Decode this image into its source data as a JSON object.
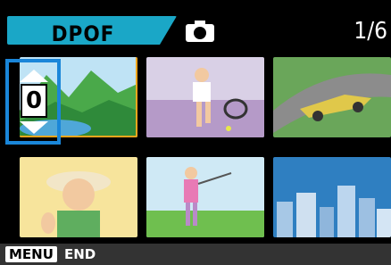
{
  "header": {
    "mode_label": "DPOF",
    "mode_icon": "camera-icon",
    "counter": "1/6"
  },
  "thumbnails": [
    {
      "subject": "mountain-lake",
      "selected": true
    },
    {
      "subject": "tennis-player",
      "selected": false
    },
    {
      "subject": "race-car",
      "selected": false
    },
    {
      "subject": "woman-portrait",
      "selected": false
    },
    {
      "subject": "golfer",
      "selected": false
    },
    {
      "subject": "city-skyline",
      "selected": false
    }
  ],
  "quantity": {
    "value": "0",
    "up_icon": "arrow-up-icon",
    "down_icon": "arrow-down-icon"
  },
  "footer": {
    "menu_label": "MENU",
    "end_label": "END"
  },
  "colors": {
    "tab": "#1aa7c7",
    "selection_frame": "#f4a51c",
    "quantity_frame": "#1a86d9",
    "background": "#000000"
  }
}
